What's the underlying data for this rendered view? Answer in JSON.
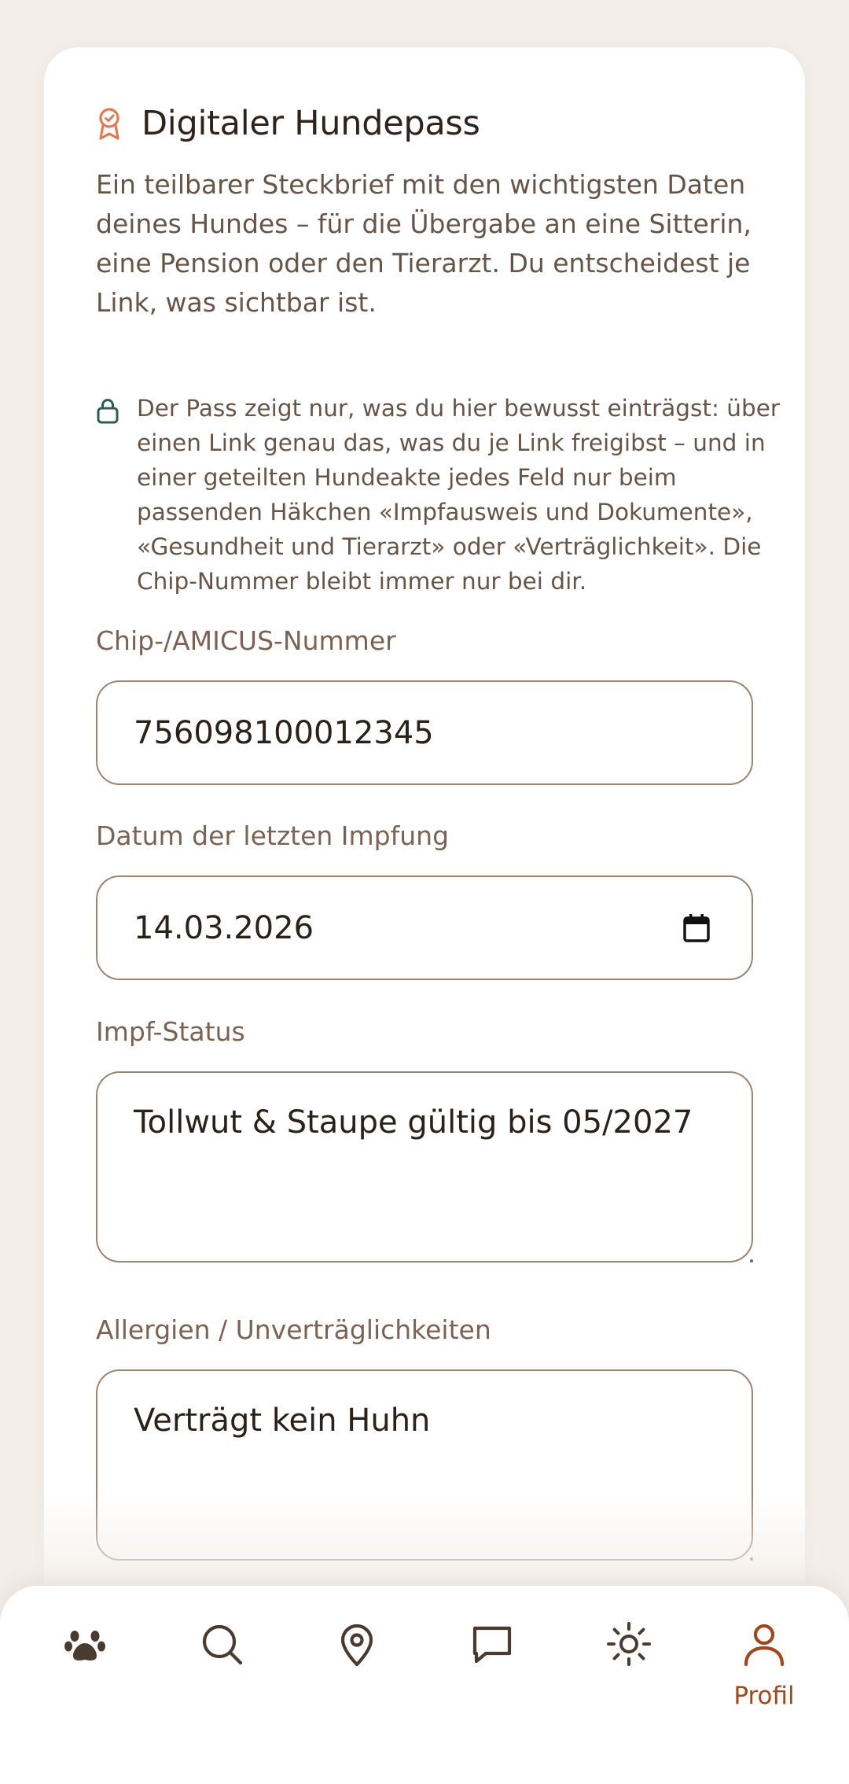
{
  "card": {
    "title": "Digitaler Hundepass",
    "intro": "Ein teilbarer Steckbrief mit den wichtigsten Daten deines Hundes – für die Übergabe an eine Sitterin, eine Pension oder den Tierarzt. Du entscheidest je Link, was sichtbar ist.",
    "privacy_note": "Der Pass zeigt nur, was du hier bewusst einträgst: über einen Link genau das, was du je Link freigibst – und in einer geteilten Hundeakte jedes Feld nur beim passenden Häkchen «Impfausweis und Dokumente», «Gesundheit und Tierarzt» oder «Verträglichkeit». Die Chip-Nummer bleibt immer nur bei dir."
  },
  "fields": {
    "chip": {
      "label": "Chip-/AMICUS-Nummer",
      "value": "756098100012345"
    },
    "vaccination_date": {
      "label": "Datum der letzten Impfung",
      "value": "14.03.2026"
    },
    "vaccination_status": {
      "label": "Impf-Status",
      "value": "Tollwut & Staupe gültig bis 05/2027"
    },
    "allergies": {
      "label": "Allergien / Unverträglichkeiten",
      "value": "Verträgt kein Huhn"
    }
  },
  "nav": {
    "items": [
      {
        "icon": "paw-icon",
        "label": ""
      },
      {
        "icon": "search-icon",
        "label": ""
      },
      {
        "icon": "map-pin-icon",
        "label": ""
      },
      {
        "icon": "chat-icon",
        "label": ""
      },
      {
        "icon": "sun-icon",
        "label": ""
      },
      {
        "icon": "user-icon",
        "label": "Profil",
        "active": true
      }
    ]
  },
  "colors": {
    "accent": "#a0471e",
    "icon_accent": "#e07a52",
    "lock": "#2f5d50",
    "text_muted": "#675448",
    "field_border": "#9b8472"
  }
}
